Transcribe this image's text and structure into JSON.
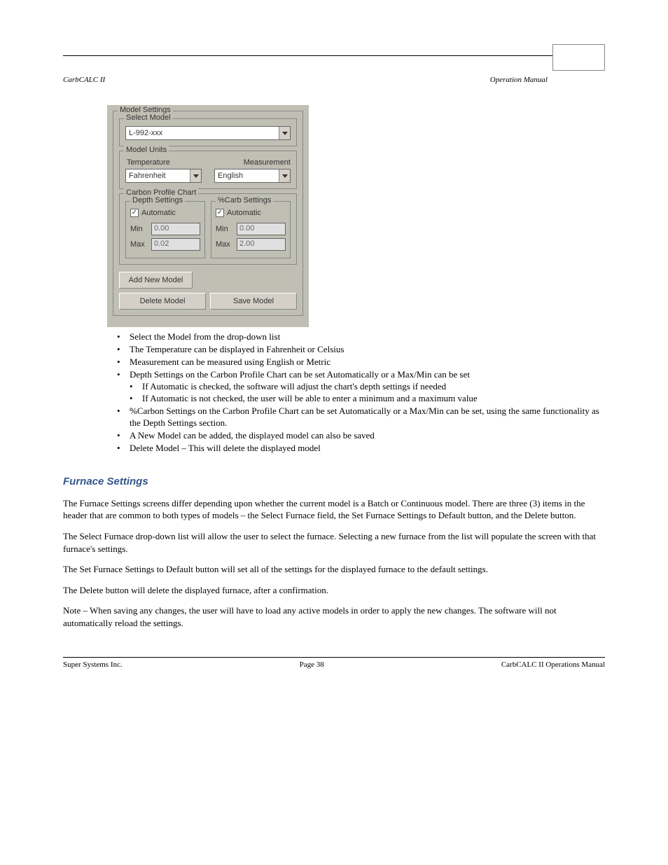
{
  "header": {
    "left_italic": "CarbCALC II",
    "right_italic": "Operation Manual"
  },
  "screenshot": {
    "model_settings": {
      "title": "Model Settings",
      "select_model": {
        "title": "Select Model",
        "value": "L-992-xxx"
      },
      "model_units": {
        "title": "Model Units",
        "temperature_label": "Temperature",
        "temperature_value": "Fahrenheit",
        "measurement_label": "Measurement",
        "measurement_value": "English"
      },
      "carbon_profile": {
        "title": "Carbon Profile Chart",
        "depth": {
          "title": "Depth Settings",
          "automatic_label": "Automatic",
          "min_label": "Min",
          "min_value": "0.00",
          "max_label": "Max",
          "max_value": "0.02"
        },
        "carb": {
          "title": "%Carb Settings",
          "automatic_label": "Automatic",
          "min_label": "Min",
          "min_value": "0.00",
          "max_label": "Max",
          "max_value": "2.00"
        }
      },
      "add_button": "Add New Model",
      "delete_button": "Delete Model",
      "save_button": "Save Model"
    }
  },
  "bullets": {
    "b1": "Select the Model from the drop-down list",
    "b2": "The Temperature can be displayed in Fahrenheit or Celsius",
    "b3": "Measurement can be measured using English or Metric",
    "b4": "Depth Settings on the Carbon Profile Chart can be set Automatically or a Max/Min can be set",
    "b4a": "If Automatic is checked, the software will adjust the chart's depth settings if needed",
    "b4b": "If Automatic is not checked, the user will be able to enter a minimum and a maximum value",
    "b5": "%Carbon Settings on the Carbon Profile Chart can be set Automatically or a Max/Min can be set, using the same functionality as the Depth Settings section.",
    "b6": "A New Model can be added, the displayed model can also be saved",
    "b7": "Delete Model – This will delete the displayed model"
  },
  "section2": {
    "heading": "Furnace Settings",
    "p1": "The Furnace Settings screens differ depending upon whether the current model is a Batch or Continuous model.  There are three (3) items in the header that are common to both types of models – the Select Furnace field, the Set Furnace Settings to Default button, and the Delete button.",
    "p2": "The Select Furnace drop-down list will allow the user to select the furnace.  Selecting a new furnace from the list will populate the screen with that furnace's settings.",
    "p3": "The Set Furnace Settings to Default button will set all of the settings for the displayed furnace to the default settings.",
    "p4": "The Delete button will delete the displayed furnace, after a confirmation.",
    "p5": "Note – When saving any changes, the user will have to load any active models in order to apply the new changes.  The software will not automatically reload the settings."
  },
  "footer": {
    "left": "Super Systems Inc.",
    "middle": "Page 38",
    "right": "CarbCALC II Operations Manual"
  }
}
